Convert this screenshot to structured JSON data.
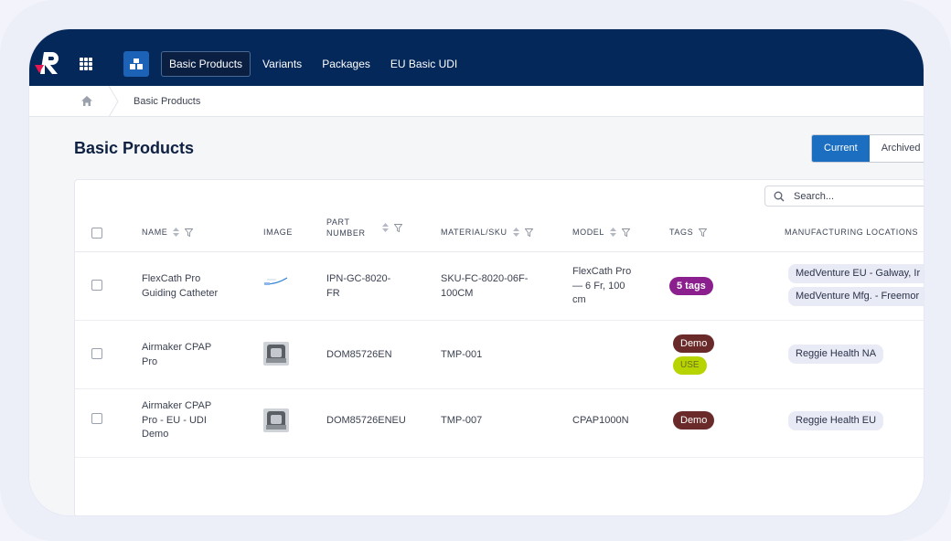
{
  "topbar": {
    "nav": [
      "Basic Products",
      "Variants",
      "Packages",
      "EU Basic UDI"
    ],
    "active_index": 0
  },
  "breadcrumb": {
    "current": "Basic Products"
  },
  "page": {
    "title": "Basic Products",
    "toggle": {
      "current": "Current",
      "archived": "Archived"
    },
    "search_placeholder": "Search..."
  },
  "table": {
    "headers": {
      "name": "NAME",
      "image": "IMAGE",
      "part_number_line1": "PART",
      "part_number_line2": "NUMBER",
      "material_sku": "MATERIAL/SKU",
      "model": "MODEL",
      "tags": "TAGS",
      "manufacturing_locations": "MANUFACTURING LOCATIONS"
    },
    "rows": [
      {
        "name_line1": "FlexCath Pro",
        "name_line2": "Guiding Catheter",
        "name_line3": "",
        "part_line1": "IPN-GC-8020-",
        "part_line2": "FR",
        "sku_line1": "SKU-FC-8020-06F-",
        "sku_line2": "100CM",
        "model_line1": "FlexCath Pro",
        "model_line2": "— 6 Fr, 100",
        "model_line3": "cm",
        "tag1": "5 tags",
        "tag2": "",
        "loc1": "MedVenture EU - Galway, Ir",
        "loc2": "MedVenture Mfg. - Freemor"
      },
      {
        "name_line1": "Airmaker CPAP",
        "name_line2": "Pro",
        "name_line3": "",
        "part_line1": "DOM85726EN",
        "sku_line1": "TMP-001",
        "model_line1": "",
        "tag1": "Demo",
        "tag2": "USE",
        "loc1": "Reggie Health NA"
      },
      {
        "name_line1": "Airmaker CPAP",
        "name_line2": "Pro - EU - UDI",
        "name_line3": "Demo",
        "part_line1": "DOM85726ENEU",
        "sku_line1": "TMP-007",
        "model_line1": "CPAP1000N",
        "tag1": "Demo",
        "loc1": "Reggie Health EU"
      }
    ]
  },
  "colors": {
    "topbar": "#04285a",
    "tag_purple": "#8a1f8d",
    "tag_demo": "#6a2a2a",
    "tag_use": "#b8d400",
    "accent": "#1c6fc0"
  }
}
